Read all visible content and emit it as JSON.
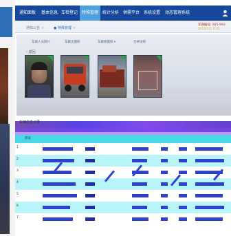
{
  "nav": {
    "items": [
      {
        "label": "通知面板"
      },
      {
        "label": "基本信息"
      },
      {
        "label": "车检登记"
      },
      {
        "label": "特殊管理"
      },
      {
        "label": "统计分析"
      },
      {
        "label": "供需平台"
      },
      {
        "label": "系统设置"
      },
      {
        "label": "动态管理系统"
      }
    ],
    "active_index": 3
  },
  "tabs": [
    {
      "label": "通知公告"
    },
    {
      "label": "● 特殊管理"
    }
  ],
  "alert": {
    "line1": "车辆编号: 925-993",
    "line2": "2019/5/1 9:45"
  },
  "photo_labels": [
    {
      "label": "车辆人员照片"
    },
    {
      "label": "车辆正面照"
    },
    {
      "label": "车辆侧面照 ▾"
    },
    {
      "label": "合格证照"
    }
  ],
  "back_label": "返回",
  "section_title": "车辆信息记录",
  "table": {
    "headers": [
      "序号",
      "",
      "",
      "",
      "",
      "",
      "",
      ""
    ],
    "rows": [
      {
        "idx": "1"
      },
      {
        "idx": "2"
      },
      {
        "idx": "3"
      },
      {
        "idx": "4"
      },
      {
        "idx": "5"
      },
      {
        "idx": "6"
      },
      {
        "idx": "7"
      }
    ]
  },
  "colors": {
    "nav_bg": "#17479a",
    "nav_active": "#4ea0de",
    "alert": "#c0282a",
    "band": "#3a22e0",
    "row_alt": "#b9f4f8",
    "cell": "#2f41cf"
  }
}
